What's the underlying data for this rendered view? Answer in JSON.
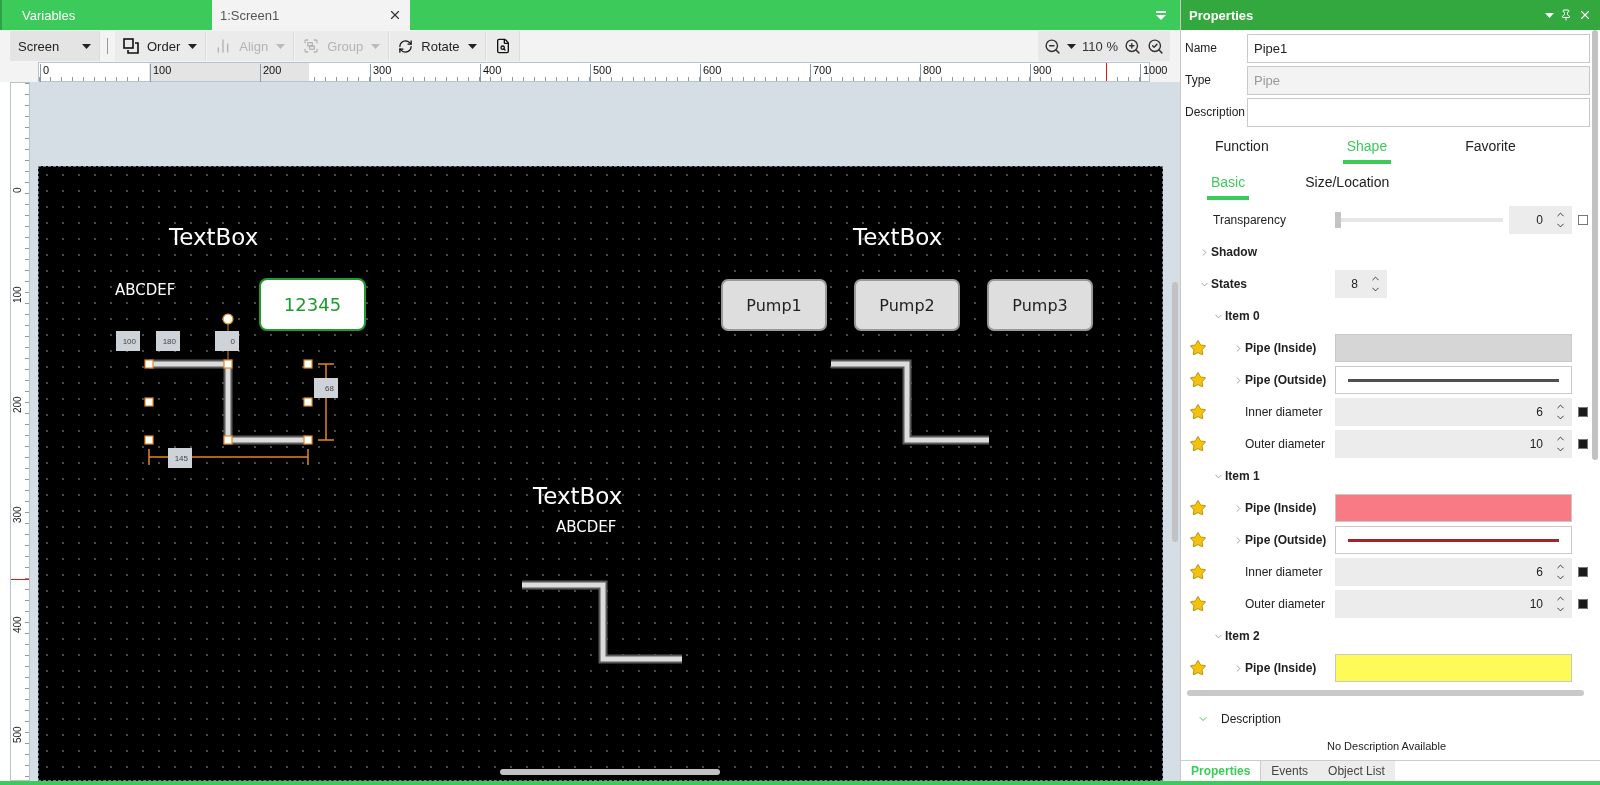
{
  "doc_tabs": [
    {
      "label": "Variables",
      "selected": false
    },
    {
      "label": "1:Screen1",
      "selected": true
    }
  ],
  "toolbar": {
    "items": [
      {
        "label": "Screen",
        "kind": "dropdown"
      },
      {
        "label": "Order",
        "kind": "menu",
        "disabled": false
      },
      {
        "label": "Align",
        "kind": "menu",
        "disabled": true
      },
      {
        "label": "Group",
        "kind": "menu",
        "disabled": true
      },
      {
        "label": "Rotate",
        "kind": "menu",
        "disabled": false
      },
      {
        "kind": "icon"
      }
    ],
    "zoom": "110 %"
  },
  "ruler": {
    "h_ticks": [
      "0",
      "100",
      "200",
      "300",
      "400",
      "500",
      "600",
      "700",
      "800",
      "900",
      "1000"
    ],
    "v_ticks": [
      "0",
      "100",
      "200",
      "300",
      "400",
      "500"
    ]
  },
  "canvas": {
    "texts": [
      {
        "kind": "title",
        "text": "TextBox"
      },
      {
        "kind": "title",
        "text": "TextBox"
      },
      {
        "kind": "title",
        "text": "TextBox"
      },
      {
        "kind": "caption",
        "text": "ABCDEF"
      },
      {
        "kind": "caption",
        "text": "ABCDEF"
      }
    ],
    "numeric_display": "12345",
    "buttons": [
      "Pump1",
      "Pump2",
      "Pump3"
    ],
    "pipes": [
      {
        "selected": true
      },
      {
        "selected": false
      },
      {
        "selected": false
      }
    ],
    "selection_labels": [
      "100",
      "180",
      "0",
      "68",
      "145"
    ]
  },
  "properties": {
    "title": "Properties",
    "fields": [
      {
        "label": "Name",
        "value": "Pipe1",
        "disabled": false
      },
      {
        "label": "Type",
        "value": "Pipe",
        "disabled": true
      },
      {
        "label": "Description",
        "disabled": false
      }
    ],
    "tabs": [
      {
        "label": "Function",
        "selected": false
      },
      {
        "label": "Shape",
        "selected": true
      },
      {
        "label": "Favorite",
        "selected": false
      }
    ],
    "subtabs": [
      {
        "label": "Basic",
        "selected": true
      },
      {
        "label": "Size/Location",
        "selected": false
      }
    ],
    "transparency": {
      "label": "Transparency",
      "value": "0",
      "level": 0,
      "checked": false
    },
    "shadow": {
      "label": "Shadow",
      "expanded": false
    },
    "states": {
      "label": "States",
      "value": "8",
      "expanded": true,
      "items": [
        {
          "label": "Item 0",
          "expanded": true,
          "props": [
            {
              "kind": "fill",
              "label": "Pipe (Inside)",
              "color": "#d6d6d6",
              "favorite": true
            },
            {
              "kind": "line",
              "label": "Pipe (Outside)",
              "color": "#505050",
              "favorite": true
            },
            {
              "kind": "number",
              "label": "Inner diameter",
              "value": "6",
              "favorite": true
            },
            {
              "kind": "number",
              "label": "Outer diameter",
              "value": "10",
              "favorite": true
            }
          ]
        },
        {
          "label": "Item 1",
          "expanded": true,
          "props": [
            {
              "kind": "fill",
              "label": "Pipe (Inside)",
              "color": "#f77a84",
              "favorite": true
            },
            {
              "kind": "line",
              "label": "Pipe (Outside)",
              "color": "#a3242e",
              "favorite": true
            },
            {
              "kind": "number",
              "label": "Inner diameter",
              "value": "6",
              "favorite": true
            },
            {
              "kind": "number",
              "label": "Outer diameter",
              "value": "10",
              "favorite": true
            }
          ]
        },
        {
          "label": "Item 2",
          "expanded": true,
          "props": [
            {
              "kind": "fill",
              "label": "Pipe (Inside)",
              "color": "#fefb58",
              "favorite": true
            }
          ]
        }
      ]
    },
    "description": {
      "title": "Description",
      "expanded": true,
      "text": "No Description Available"
    },
    "bottom_tabs": [
      {
        "label": "Properties",
        "selected": true
      },
      {
        "label": "Events",
        "selected": false
      },
      {
        "label": "Object List",
        "selected": false
      }
    ]
  }
}
